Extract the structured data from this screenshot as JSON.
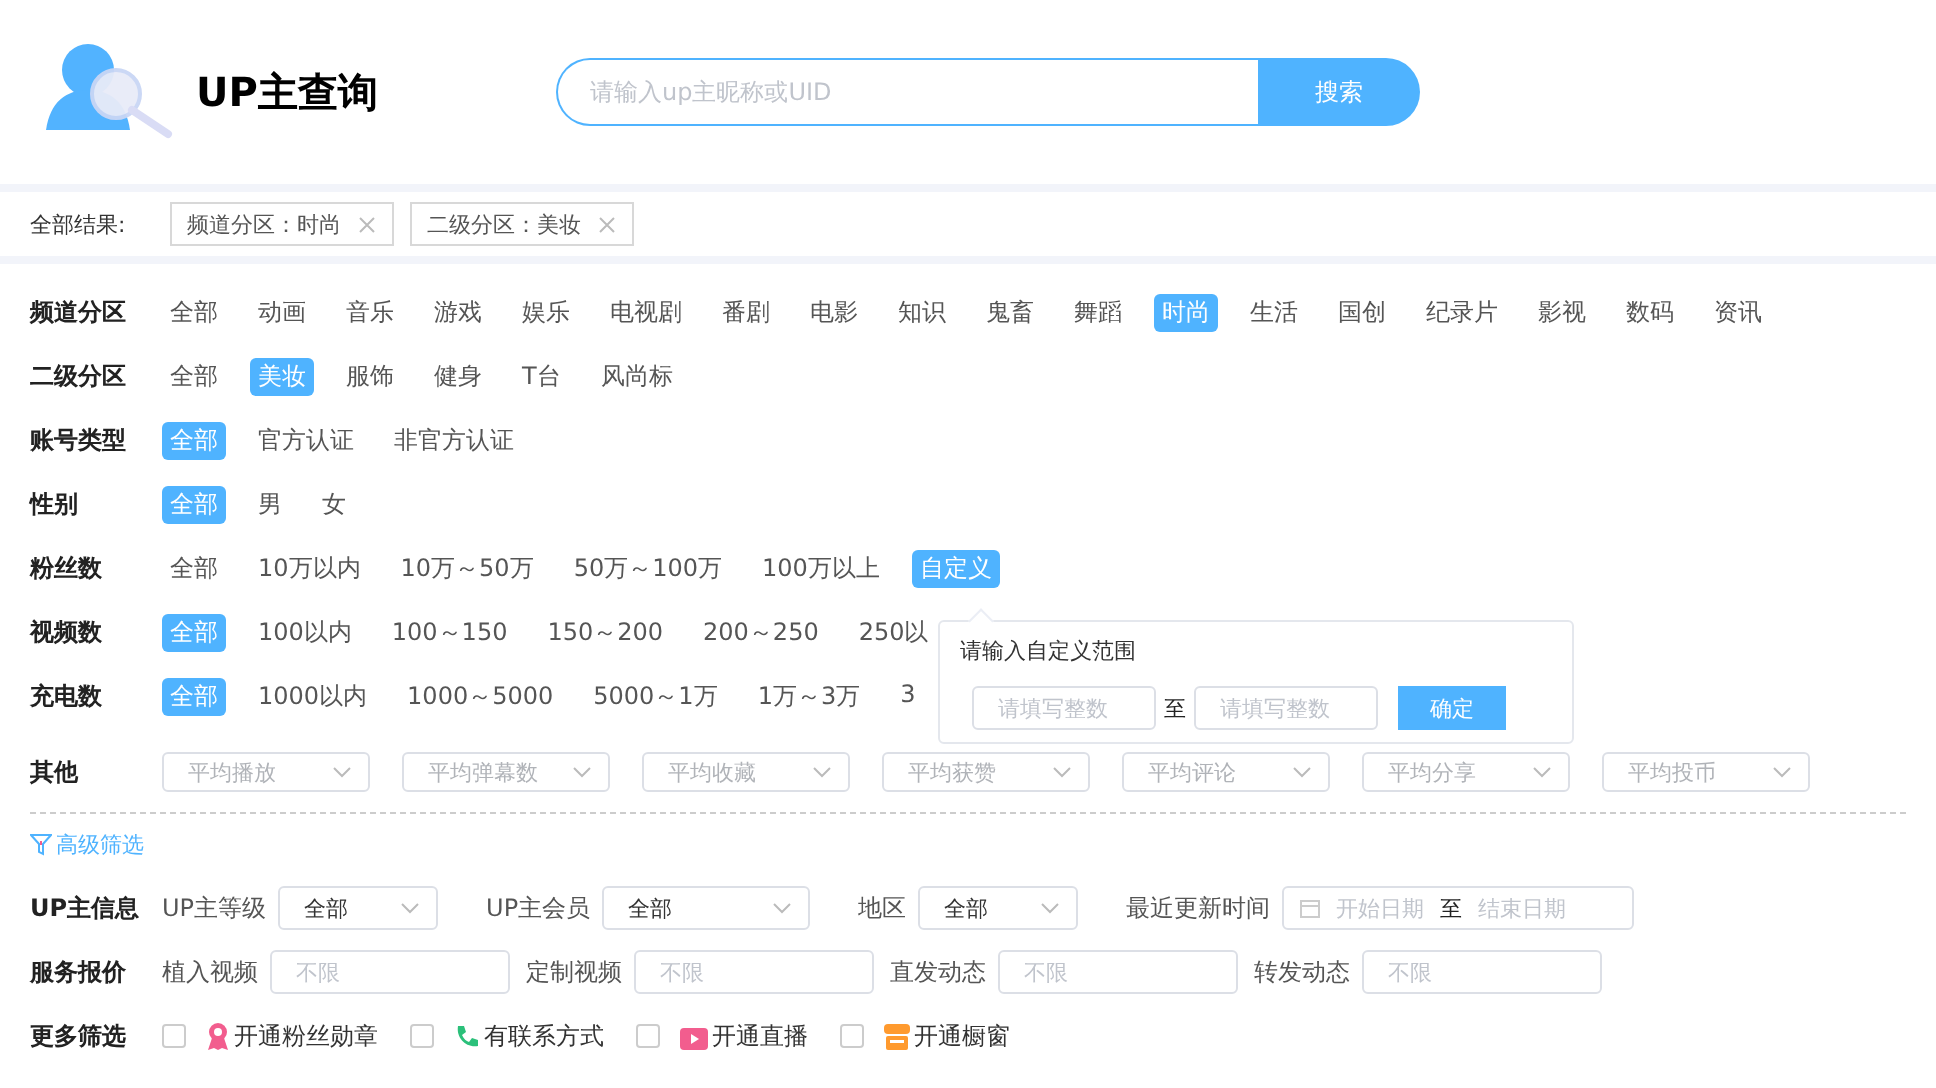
{
  "header": {
    "title": "UP主查询",
    "search": {
      "placeholder": "请输入up主昵称或UID",
      "button": "搜索"
    }
  },
  "results": {
    "label": "全部结果:",
    "tags": [
      {
        "text": "频道分区：时尚"
      },
      {
        "text": "二级分区：美妆"
      }
    ]
  },
  "filters": [
    {
      "label": "频道分区",
      "options": [
        {
          "text": "全部",
          "selected": false
        },
        {
          "text": "动画",
          "selected": false
        },
        {
          "text": "音乐",
          "selected": false
        },
        {
          "text": "游戏",
          "selected": false
        },
        {
          "text": "娱乐",
          "selected": false
        },
        {
          "text": "电视剧",
          "selected": false
        },
        {
          "text": "番剧",
          "selected": false
        },
        {
          "text": "电影",
          "selected": false
        },
        {
          "text": "知识",
          "selected": false
        },
        {
          "text": "鬼畜",
          "selected": false
        },
        {
          "text": "舞蹈",
          "selected": false
        },
        {
          "text": "时尚",
          "selected": true
        },
        {
          "text": "生活",
          "selected": false
        },
        {
          "text": "国创",
          "selected": false
        },
        {
          "text": "纪录片",
          "selected": false
        },
        {
          "text": "影视",
          "selected": false
        },
        {
          "text": "数码",
          "selected": false
        },
        {
          "text": "资讯",
          "selected": false
        }
      ]
    },
    {
      "label": "二级分区",
      "options": [
        {
          "text": "全部",
          "selected": false
        },
        {
          "text": "美妆",
          "selected": true
        },
        {
          "text": "服饰",
          "selected": false
        },
        {
          "text": "健身",
          "selected": false
        },
        {
          "text": "T台",
          "selected": false
        },
        {
          "text": "风尚标",
          "selected": false
        }
      ]
    },
    {
      "label": "账号类型",
      "options": [
        {
          "text": "全部",
          "selected": true
        },
        {
          "text": "官方认证",
          "selected": false
        },
        {
          "text": "非官方认证",
          "selected": false
        }
      ]
    },
    {
      "label": "性别",
      "options": [
        {
          "text": "全部",
          "selected": true
        },
        {
          "text": "男",
          "selected": false
        },
        {
          "text": "女",
          "selected": false
        }
      ]
    },
    {
      "label": "粉丝数",
      "options": [
        {
          "text": "全部",
          "selected": false
        },
        {
          "text": "10万以内",
          "selected": false
        },
        {
          "text": "10万～50万",
          "selected": false
        },
        {
          "text": "50万～100万",
          "selected": false
        },
        {
          "text": "100万以上",
          "selected": false
        },
        {
          "text": "自定义",
          "selected": true
        }
      ]
    },
    {
      "label": "视频数",
      "options": [
        {
          "text": "全部",
          "selected": true
        },
        {
          "text": "100以内",
          "selected": false
        },
        {
          "text": "100～150",
          "selected": false
        },
        {
          "text": "150～200",
          "selected": false
        },
        {
          "text": "200～250",
          "selected": false
        },
        {
          "text": "250以",
          "selected": false
        }
      ]
    },
    {
      "label": "充电数",
      "options": [
        {
          "text": "全部",
          "selected": true
        },
        {
          "text": "1000以内",
          "selected": false
        },
        {
          "text": "1000～5000",
          "selected": false
        },
        {
          "text": "5000～1万",
          "selected": false
        },
        {
          "text": "1万～3万",
          "selected": false
        },
        {
          "text": "3",
          "selected": false
        }
      ]
    }
  ],
  "other": {
    "label": "其他",
    "selects": [
      {
        "placeholder": "平均播放"
      },
      {
        "placeholder": "平均弹幕数"
      },
      {
        "placeholder": "平均收藏"
      },
      {
        "placeholder": "平均获赞"
      },
      {
        "placeholder": "平均评论"
      },
      {
        "placeholder": "平均分享"
      },
      {
        "placeholder": "平均投币"
      }
    ]
  },
  "popover": {
    "title": "请输入自定义范围",
    "inputs": [
      {
        "placeholder": "请填写整数"
      },
      {
        "placeholder": "请填写整数"
      }
    ],
    "separator": "至",
    "button": "确定"
  },
  "advanced": {
    "label": "高级筛选"
  },
  "info": {
    "label": "UP主信息",
    "fields": [
      {
        "kind": "select",
        "label": "UP主等级",
        "value": "全部"
      },
      {
        "kind": "select",
        "label": "UP主会员",
        "value": "全部"
      },
      {
        "kind": "select",
        "label": "地区",
        "value": "全部"
      },
      {
        "kind": "daterange",
        "label": "最近更新时间",
        "start_placeholder": "开始日期",
        "separator": "至",
        "end_placeholder": "结束日期"
      }
    ]
  },
  "pricing": {
    "label": "服务报价",
    "fields": [
      {
        "label": "植入视频",
        "placeholder": "不限"
      },
      {
        "label": "定制视频",
        "placeholder": "不限"
      },
      {
        "label": "直发动态",
        "placeholder": "不限"
      },
      {
        "label": "转发动态",
        "placeholder": "不限"
      }
    ]
  },
  "more": {
    "label": "更多筛选",
    "options": [
      {
        "kind": "medal",
        "label": "开通粉丝勋章",
        "checked": false
      },
      {
        "kind": "phone",
        "label": "有联系方式",
        "checked": false
      },
      {
        "kind": "live",
        "label": "开通直播",
        "checked": false
      },
      {
        "kind": "shop",
        "label": "开通橱窗",
        "checked": false
      }
    ]
  }
}
